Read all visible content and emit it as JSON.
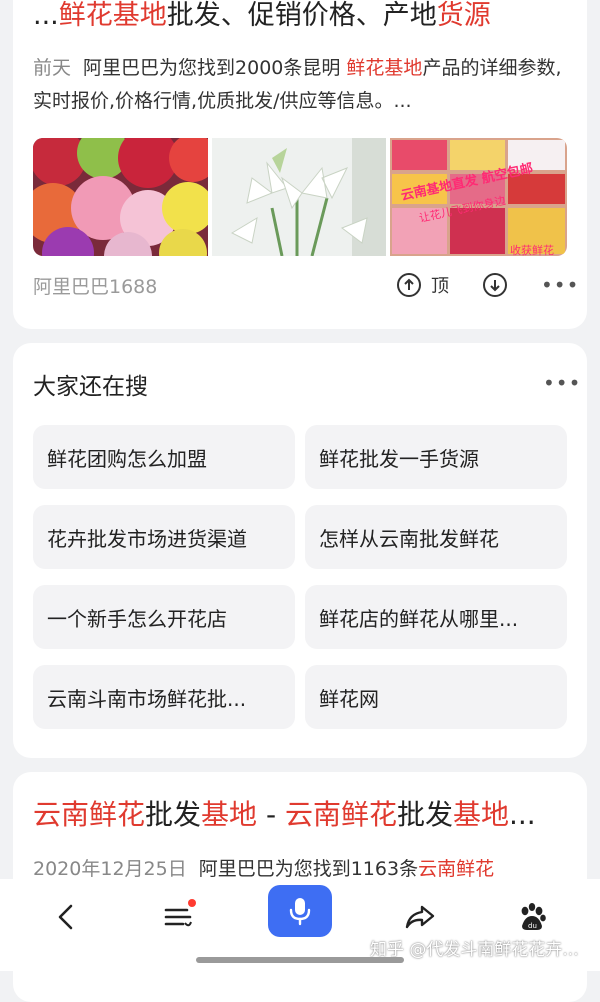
{
  "result1": {
    "title_parts": [
      {
        "text": "...",
        "hl": false
      },
      {
        "text": "鲜花基地",
        "hl": true
      },
      {
        "text": "批发、促销价格、产地",
        "hl": false
      },
      {
        "text": "货源",
        "hl": true
      }
    ],
    "time": "前天",
    "snippet_a": "阿里巴巴为您找到2000条昆明 ",
    "snippet_hl": "鲜花基地",
    "snippet_b": "产品的详细参数,实时报价,价格行情,优质批发/供应等信息。...",
    "images": [
      {
        "desc": "carnations",
        "colors": [
          "#c62a3c",
          "#f19ab6",
          "#f2e14b",
          "#e86a3a",
          "#9b3bb0"
        ]
      },
      {
        "desc": "white lilies",
        "colors": [
          "#ffffff",
          "#cfd9cc",
          "#7aa56a"
        ]
      },
      {
        "desc": "flower market boxes",
        "colors": [
          "#e84b6a",
          "#f7c44a",
          "#d63a3a",
          "#f6f0f2"
        ]
      }
    ],
    "image3_overlay": "云南基地直发 航空包邮",
    "image3_overlay2": "让花儿飞到你身边",
    "image3_corner": "收获鲜花",
    "source": "阿里巴巴1688",
    "top_label": "顶",
    "more": "•••"
  },
  "related": {
    "title": "大家还在搜",
    "more": "•••",
    "chips": [
      "鲜花团购怎么加盟",
      "鲜花批发一手货源",
      "花卉批发市场进货渠道",
      "怎样从云南批发鲜花",
      "一个新手怎么开花店",
      "鲜花店的鲜花从哪里...",
      "云南斗南市场鲜花批...",
      "鲜花网"
    ]
  },
  "result2": {
    "title_parts": [
      {
        "text": "云南鲜花",
        "hl": true
      },
      {
        "text": "批发",
        "hl": false
      },
      {
        "text": "基地",
        "hl": true
      },
      {
        "text": " - ",
        "hl": false
      },
      {
        "text": "云南鲜花",
        "hl": true
      },
      {
        "text": "批发",
        "hl": false
      },
      {
        "text": "基地",
        "hl": true
      },
      {
        "text": "...",
        "hl": false
      }
    ],
    "time": "2020年12月25日",
    "snippet_a": "阿里巴巴为您找到1163条",
    "snippet_hl": "云南鲜花"
  },
  "nav": {
    "icons": [
      "back-icon",
      "menu-icon",
      "mic-icon",
      "share-icon",
      "baidu-paw-icon"
    ],
    "watermark": "知乎 @代发斗南鲜花花卉..."
  },
  "colors": {
    "highlight": "#e03a2f",
    "mic_blue": "#3e6ef3",
    "page_bg": "#f1f2f4"
  }
}
